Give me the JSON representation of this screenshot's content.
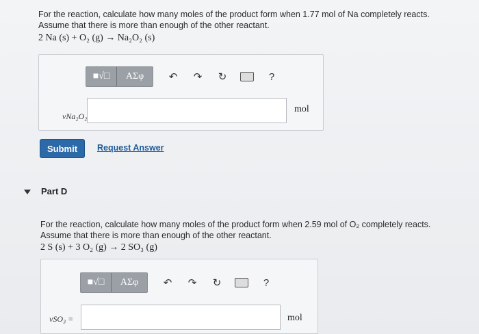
{
  "partC": {
    "question_line1": "For the reaction, calculate how many moles of the product form when 1.77 mol of Na completely reacts.",
    "question_line2": "Assume that there is more than enough of the other reactant.",
    "equation": "2 Na (s) + O₂ (g) → Na₂O₂ (s)",
    "variable_label": "νNa₂O₂ =",
    "answer_value": "",
    "unit": "mol",
    "submit_label": "Submit",
    "request_answer_label": "Request Answer"
  },
  "partD": {
    "title": "Part D",
    "question_line1": "For the reaction, calculate how many moles of the product form when 2.59 mol of O₂ completely reacts.",
    "question_line2": "Assume that there is more than enough of the other reactant.",
    "equation": "2 S (s) + 3 O₂ (g) → 2 SO₃ (g)",
    "variable_label": "νSO₃ =",
    "answer_value": "",
    "unit": "mol"
  },
  "toolbar": {
    "math_symbol": "■√□",
    "greek_symbol": "ΑΣφ",
    "undo_icon": "↶",
    "redo_icon": "↷",
    "reset_icon": "↻",
    "help_icon": "?"
  },
  "icons": [
    "templates-icon",
    "greek-icon",
    "undo-icon",
    "redo-icon",
    "reset-icon",
    "keyboard-icon",
    "help-icon",
    "caret-down-icon"
  ]
}
